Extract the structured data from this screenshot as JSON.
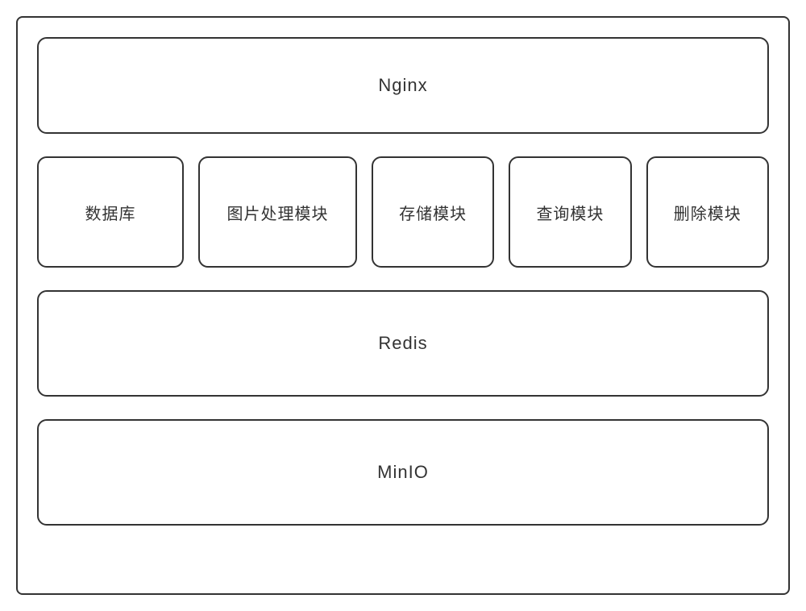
{
  "layers": {
    "top": {
      "label": "Nginx"
    },
    "modules": [
      {
        "label": "数据库"
      },
      {
        "label": "图片处理模块"
      },
      {
        "label": "存储模块"
      },
      {
        "label": "查询模块"
      },
      {
        "label": "删除模块"
      }
    ],
    "cache": {
      "label": "Redis"
    },
    "storage": {
      "label": "MinIO"
    }
  }
}
